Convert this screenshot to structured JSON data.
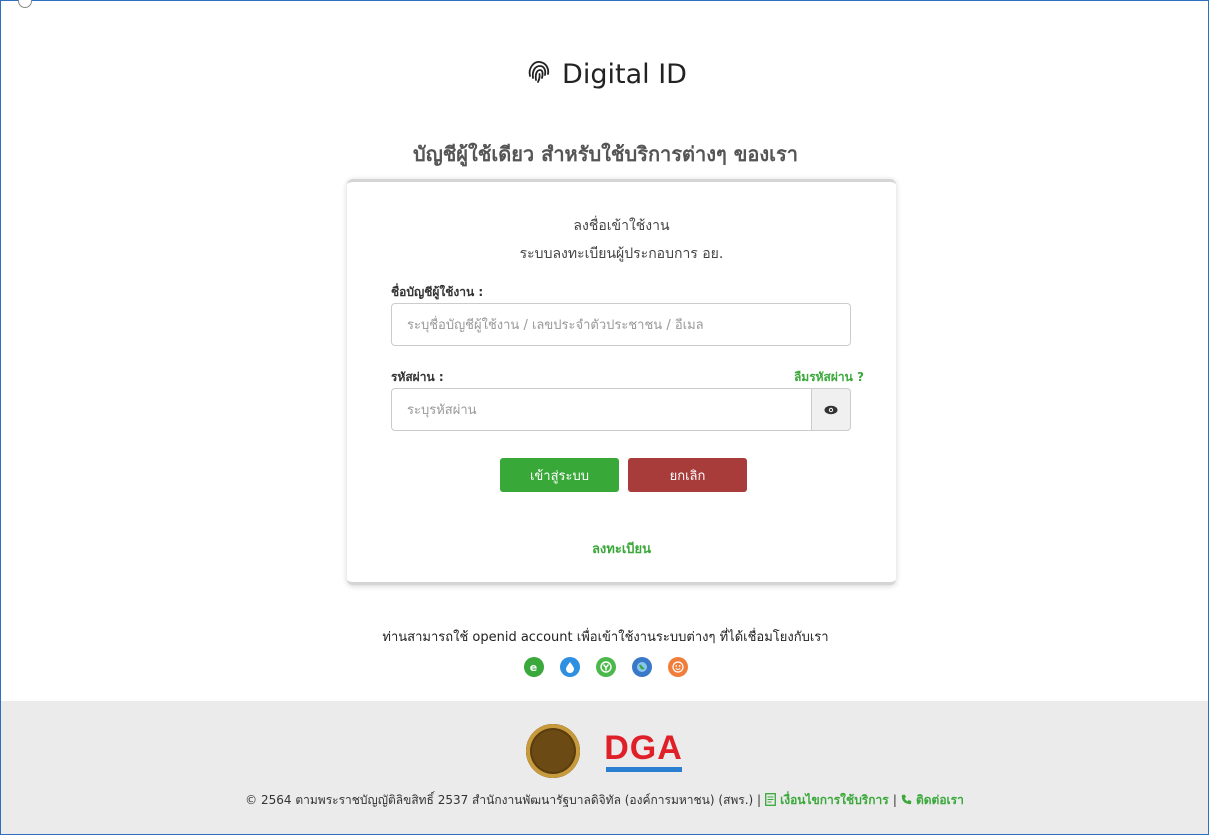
{
  "brand": {
    "title": "Digital ID",
    "icon": "fingerprint-icon"
  },
  "tagline": "บัญชีผู้ใช้เดียว สำหรับใช้บริการต่างๆ ของเรา",
  "login_card": {
    "title": "ลงชื่อเข้าใช้งาน",
    "subtitle": "ระบบลงทะเบียนผู้ประกอบการ อย.",
    "username_label": "ชื่อบัญชีผู้ใช้งาน :",
    "username_placeholder": "ระบุชื่อบัญชีผู้ใช้งาน / เลขประจำตัวประชาชน / อีเมล",
    "password_label": "รหัสผ่าน :",
    "password_placeholder": "ระบุรหัสผ่าน",
    "forgot_password": "ลืมรหัสผ่าน ?",
    "login_button": "เข้าสู่ระบบ",
    "cancel_button": "ยกเลิก",
    "register_link": "ลงทะเบียน"
  },
  "openid": {
    "text": "ท่านสามารถใช้ openid account เพื่อเข้าใช้งานระบบต่างๆ ที่ได้เชื่อมโยงกับเรา",
    "providers": [
      {
        "icon": "e-provider-icon",
        "color": "#3aa83a"
      },
      {
        "icon": "drop-provider-icon",
        "color": "#2f8fe0"
      },
      {
        "icon": "y-provider-icon",
        "color": "#4cb84c"
      },
      {
        "icon": "globe-provider-icon",
        "color": "#3a78c8"
      },
      {
        "icon": "face-provider-icon",
        "color": "#f07d3a"
      }
    ]
  },
  "footer": {
    "dga_logo": "DGA",
    "copyright": "© 2564 ตามพระราชบัญญัติลิขสิทธิ์ 2537 สำนักงานพัฒนารัฐบาลดิจิทัล (องค์การมหาชน) (สพร.) |",
    "terms_link": "เงื่อนไขการใช้บริการ",
    "separator": "|",
    "contact_link": "ติดต่อเรา"
  }
}
